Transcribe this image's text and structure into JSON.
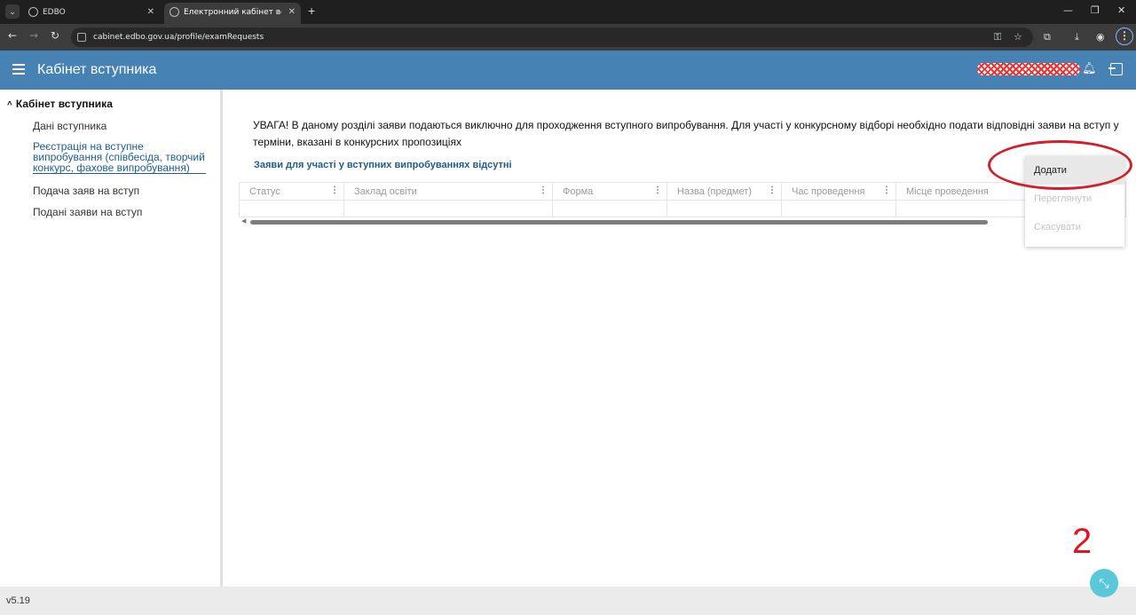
{
  "browser": {
    "tabs": [
      {
        "title": "EDBO"
      },
      {
        "title": "Електронний кабінет вступника"
      }
    ],
    "new_tab": "+",
    "url": "cabinet.edbo.gov.ua/profile/examRequests"
  },
  "app": {
    "title": "Кабінет вступника"
  },
  "sidebar": {
    "header": "Кабінет вступника",
    "items": [
      {
        "label": "Дані вступника"
      },
      {
        "label": "Реєстрація на вступне випробування (співбесіда, творчий конкурс, фахове випробування)"
      },
      {
        "label": "Подача заяв на вступ"
      },
      {
        "label": "Подані заяви на вступ"
      }
    ]
  },
  "main": {
    "notice": "УВАГА! В даному розділі заяви подаються виключно для проходження вступного випробування. Для участі у конкурсному відборі необхідно подати відповідні заяви на вступ у терміни, вказані в конкурсних пропозиціях",
    "empty_message": "Заяви для участі у вступних випробуваннях відсутні",
    "columns": [
      {
        "label": "Статус"
      },
      {
        "label": "Заклад освіти"
      },
      {
        "label": "Форма"
      },
      {
        "label": "Назва (предмет)"
      },
      {
        "label": "Час проведення"
      },
      {
        "label": "Місце проведення"
      }
    ]
  },
  "actions_menu": {
    "items": [
      {
        "label": "Додати",
        "enabled": true
      },
      {
        "label": "Переглянути",
        "enabled": false
      },
      {
        "label": "Скасувати",
        "enabled": false
      }
    ]
  },
  "annotation": {
    "step": "2"
  },
  "footer": {
    "version": "v5.19"
  },
  "colors": {
    "header": "#4682b4",
    "link": "#1e5d8c",
    "annotation": "#e0151f",
    "fab": "#5bc8d9"
  }
}
